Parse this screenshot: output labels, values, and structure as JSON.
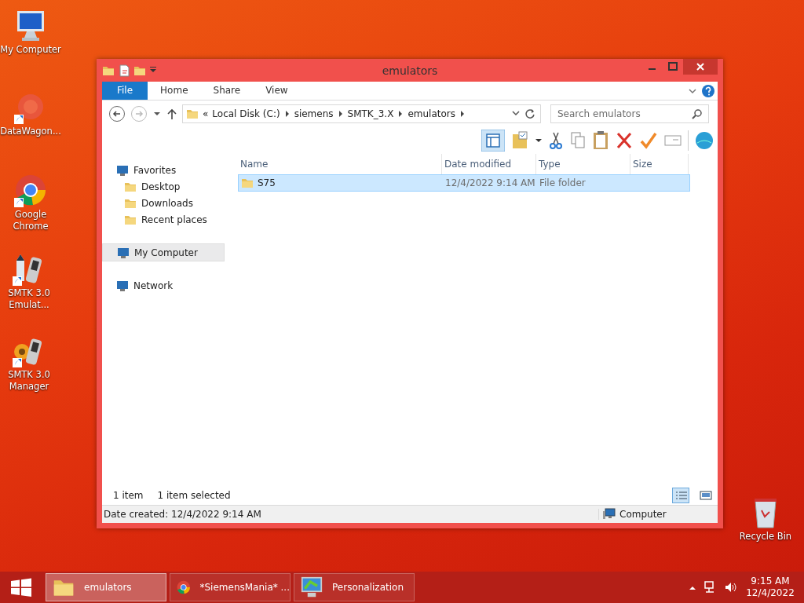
{
  "desktop_icons": [
    {
      "label": "My Computer",
      "shortcut": false
    },
    {
      "label": "DataWagon...",
      "shortcut": true
    },
    {
      "label": "Google Chrome",
      "shortcut": true
    },
    {
      "label": "SMTK 3.0 Emulat...",
      "shortcut": true
    },
    {
      "label": "SMTK 3.0 Manager",
      "shortcut": true
    },
    {
      "label": "Recycle Bin",
      "shortcut": false
    }
  ],
  "window": {
    "title": "emulators",
    "ribbon_tabs": [
      {
        "label": "File",
        "kind": "menu",
        "selected": false
      },
      {
        "label": "Home",
        "kind": "tab",
        "selected": false
      },
      {
        "label": "Share",
        "kind": "tab",
        "selected": false
      },
      {
        "label": "View",
        "kind": "tab",
        "selected": false
      }
    ],
    "address_bar": {
      "overflow": "«",
      "segments": [
        "Local Disk (C:)",
        "siemens",
        "SMTK_3.X",
        "emulators"
      ]
    },
    "search": {
      "placeholder": "Search emulators"
    },
    "navigation": [
      {
        "label": "Favorites",
        "selected": false,
        "children": [
          {
            "label": "Desktop",
            "selected": false
          },
          {
            "label": "Downloads",
            "selected": false
          },
          {
            "label": "Recent places",
            "selected": false
          }
        ]
      },
      {
        "label": "My Computer",
        "selected": true
      },
      {
        "label": "Network",
        "selected": false
      }
    ],
    "columns": [
      "Name",
      "Date modified",
      "Type",
      "Size"
    ],
    "rows": [
      {
        "name": "S75",
        "date_modified": "12/4/2022 9:14 AM",
        "type": "File folder",
        "selected": true
      }
    ],
    "item_count": "1 item",
    "selection_count": "1 item selected",
    "view_buttons": [
      {
        "selected": true
      },
      {
        "selected": false
      }
    ],
    "status_bar": {
      "details": "Date created: 12/4/2022 9:14 AM",
      "location": "Computer"
    }
  },
  "taskbar": {
    "items": [
      {
        "label": "emulators",
        "selected": true
      },
      {
        "label": "*SiemensMania* ...",
        "selected": false
      },
      {
        "label": "Personalization",
        "selected": false
      }
    ],
    "time": "9:15 AM",
    "date": "12/4/2022"
  }
}
